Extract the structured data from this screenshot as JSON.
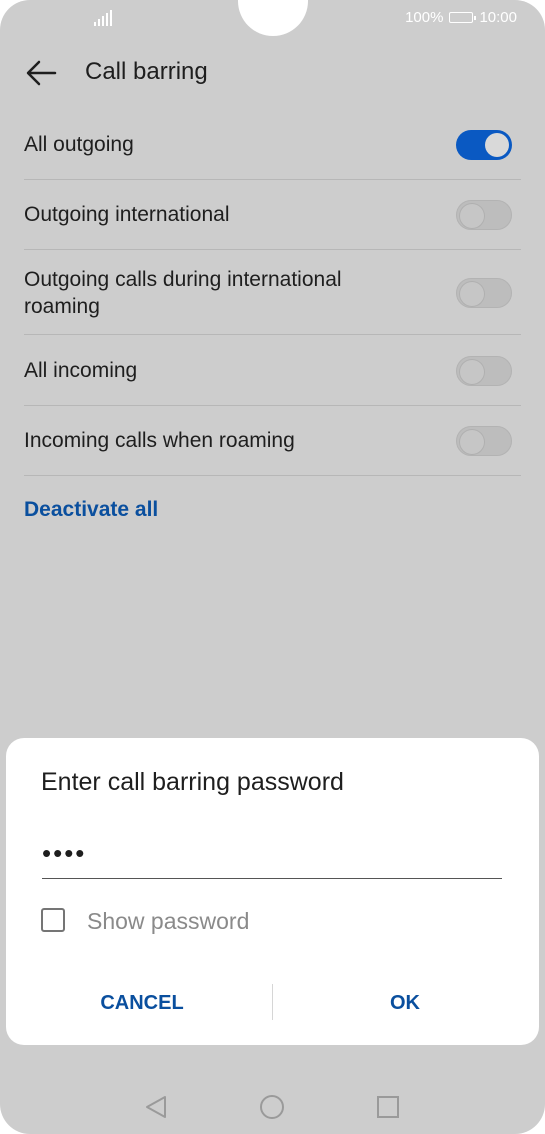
{
  "status_bar": {
    "battery_text": "100%",
    "time": "10:00",
    "icons": [
      "signal-icon",
      "battery-icon"
    ]
  },
  "header": {
    "title": "Call barring",
    "back_icon": "back-arrow-icon"
  },
  "settings": [
    {
      "label": "All outgoing",
      "enabled": true
    },
    {
      "label": "Outgoing international",
      "enabled": false
    },
    {
      "label": "Outgoing calls during international roaming",
      "enabled": false
    },
    {
      "label": "All incoming",
      "enabled": false
    },
    {
      "label": "Incoming calls when roaming",
      "enabled": false
    }
  ],
  "deactivate_all_label": "Deactivate all",
  "dialog": {
    "title": "Enter call barring password",
    "password_value": "••••",
    "show_password_label": "Show password",
    "show_password_checked": false,
    "cancel_label": "CANCEL",
    "ok_label": "OK"
  },
  "nav_bar": {
    "icons": [
      "back-triangle-icon",
      "home-circle-icon",
      "recents-square-icon"
    ]
  },
  "colors": {
    "accent": "#0a59c2",
    "link": "#0a4f9e",
    "scrim_background": "#cdcdcd"
  }
}
